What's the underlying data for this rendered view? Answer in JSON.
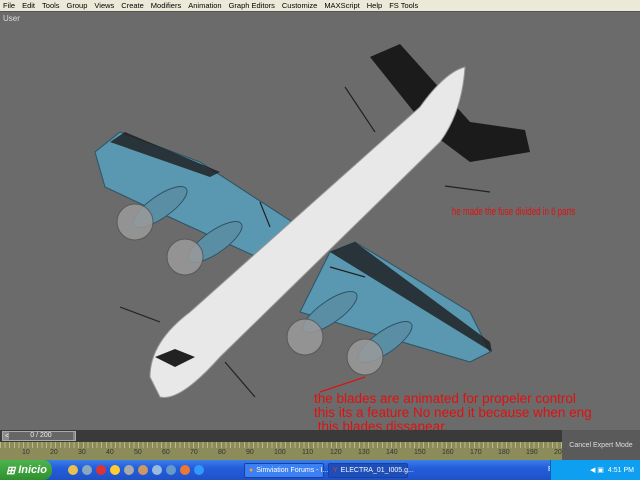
{
  "menu": [
    "File",
    "Edit",
    "Tools",
    "Group",
    "Views",
    "Create",
    "Modifiers",
    "Animation",
    "Graph Editors",
    "Customize",
    "MAXScript",
    "Help",
    "FS Tools"
  ],
  "viewport": {
    "label": "User"
  },
  "annotations": {
    "fuse": "he made the fuse divided in 6 parts",
    "blades_line1": "the blades are animated for propeler control",
    "blades_line2": "this its a feature No need it because when eng",
    "blades_line3": " this blades dissapear."
  },
  "timeline": {
    "frame": "0 / 200",
    "ticks": [
      "10",
      "20",
      "30",
      "40",
      "50",
      "60",
      "70",
      "80",
      "90",
      "100",
      "110",
      "120",
      "130",
      "140",
      "150",
      "160",
      "170",
      "180",
      "190",
      "20"
    ],
    "cancel": "Cancel Expert Mode"
  },
  "taskbar": {
    "start": "Inicio",
    "tasks": [
      "Simviation Forums - I...",
      "ELECTRA_01_I005.g..."
    ],
    "lang": "ES",
    "clock": "4:51 PM"
  },
  "colors": {
    "annotation": "#e01010",
    "wing": "#5a97b0",
    "fuselage": "#e8e8e8"
  }
}
